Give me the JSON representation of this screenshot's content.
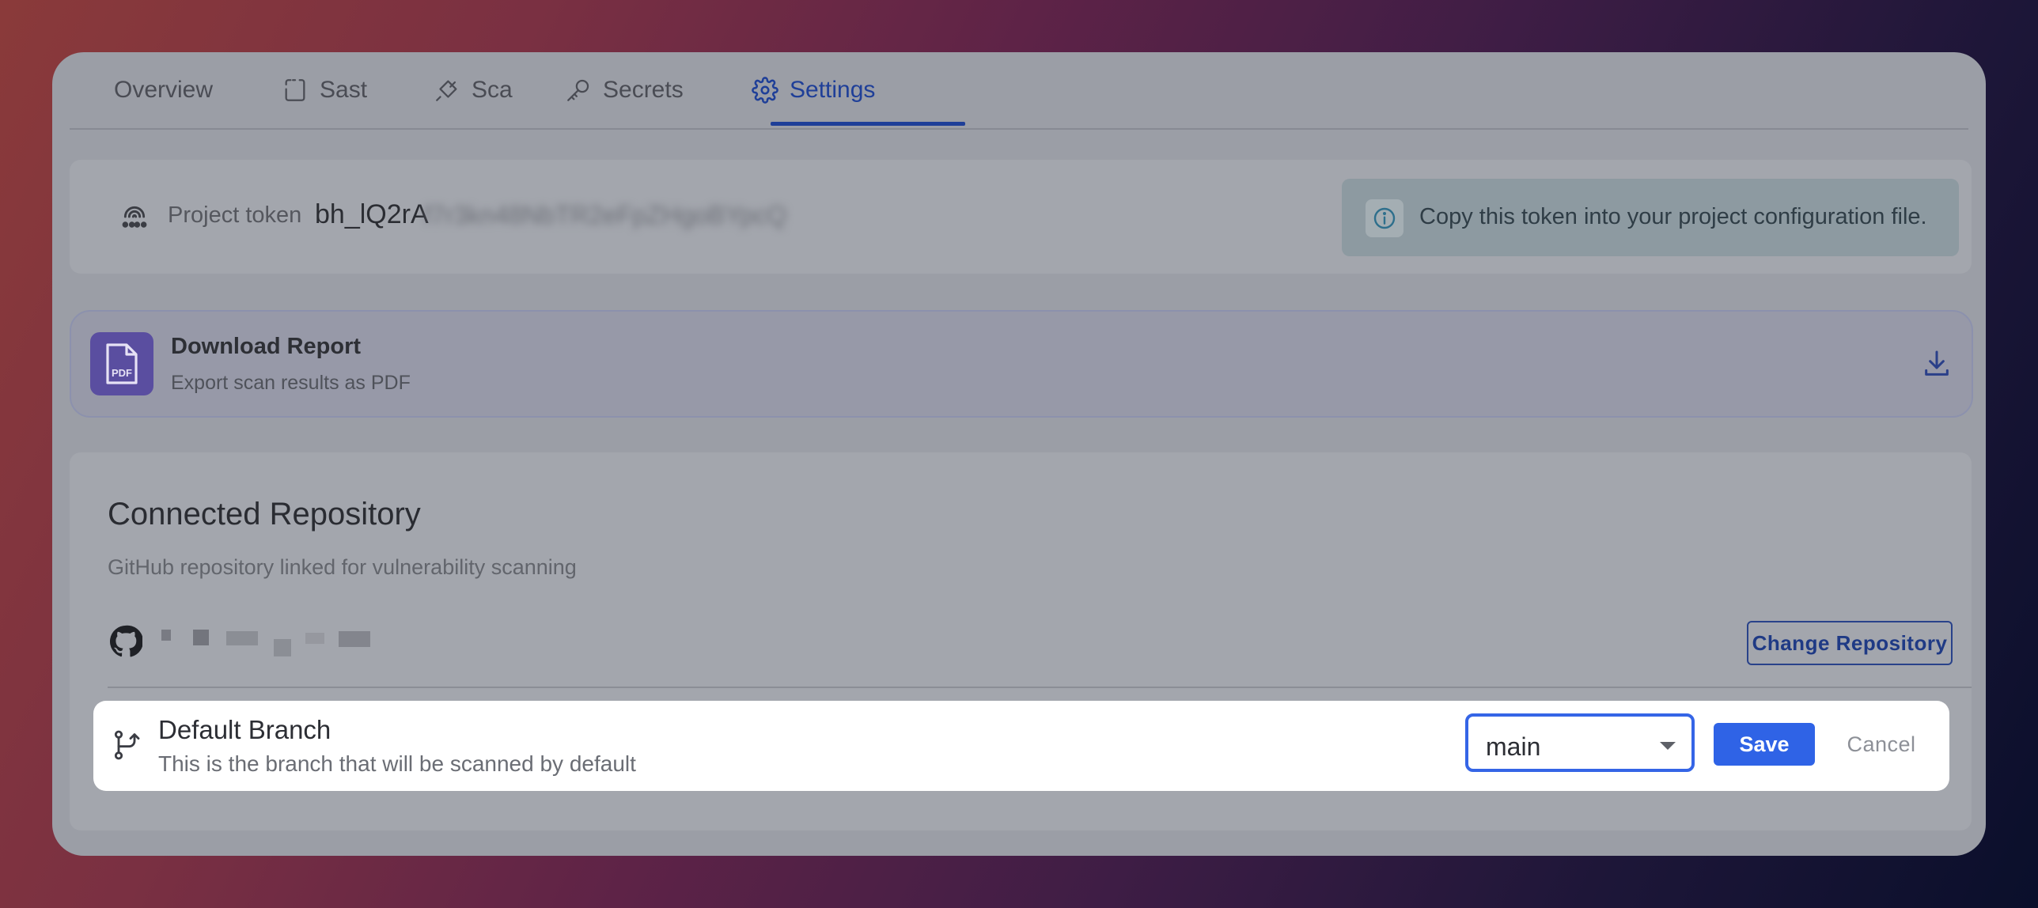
{
  "tabs": [
    {
      "label": "Overview",
      "icon": ""
    },
    {
      "label": "Sast",
      "icon": "code-scan-icon"
    },
    {
      "label": "Sca",
      "icon": "bug-icon"
    },
    {
      "label": "Secrets",
      "icon": "key-icon"
    },
    {
      "label": "Settings",
      "icon": "gear-icon",
      "active": true
    }
  ],
  "token": {
    "label": "Project token",
    "value_visible": "bh_lQ2rA",
    "value_blurred": "f7r3kn48NbTR2eFpZHgoBYpcQ",
    "info": "Copy this token into your project configuration file."
  },
  "download": {
    "badge": "PDF",
    "title": "Download Report",
    "subtitle": "Export scan results as PDF"
  },
  "repository": {
    "title": "Connected Repository",
    "subtitle": "GitHub repository linked for vulnerability scanning",
    "change_button": "Change Repository"
  },
  "branch": {
    "title": "Default Branch",
    "subtitle": "This is the branch that will be scanned by default",
    "selected": "main",
    "save": "Save",
    "cancel": "Cancel"
  },
  "colors": {
    "accent": "#2f63e6",
    "tab_active": "#1f3f98"
  }
}
